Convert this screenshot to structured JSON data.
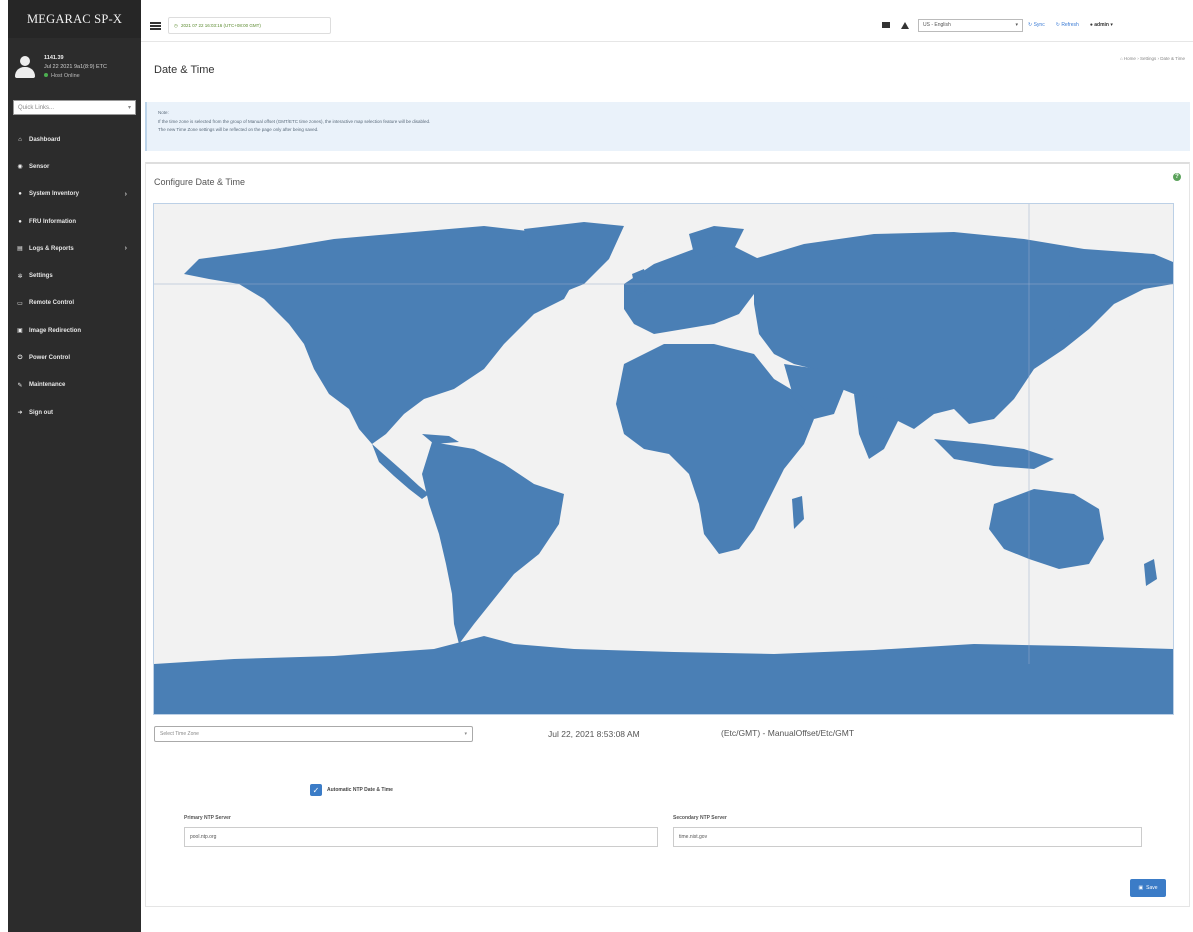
{
  "sidebar": {
    "brand": "MEGARAC SP-X",
    "user": {
      "name": "1141.39",
      "date": "Jul 22 2021 9a1(8:9) ETC",
      "status": "Host Online"
    },
    "quicklinks_placeholder": "Quick Links...",
    "items": [
      {
        "label": "Dashboard",
        "icon": "home-icon",
        "glyph": "⌂",
        "caret": false
      },
      {
        "label": "Sensor",
        "icon": "sensor-icon",
        "glyph": "◉",
        "caret": false
      },
      {
        "label": "System Inventory",
        "icon": "inventory-icon",
        "glyph": "●",
        "caret": true
      },
      {
        "label": "FRU Information",
        "icon": "fru-icon",
        "glyph": "●",
        "caret": false
      },
      {
        "label": "Logs & Reports",
        "icon": "chart-icon",
        "glyph": "▤",
        "caret": true
      },
      {
        "label": "Settings",
        "icon": "gear-icon",
        "glyph": "✲",
        "caret": false
      },
      {
        "label": "Remote Control",
        "icon": "monitor-icon",
        "glyph": "▭",
        "caret": false
      },
      {
        "label": "Image Redirection",
        "icon": "disc-icon",
        "glyph": "▣",
        "caret": false
      },
      {
        "label": "Power Control",
        "icon": "power-icon",
        "glyph": "⏻",
        "caret": false
      },
      {
        "label": "Maintenance",
        "icon": "wrench-icon",
        "glyph": "✎",
        "caret": false
      },
      {
        "label": "Sign out",
        "icon": "signout-icon",
        "glyph": "➜",
        "caret": false
      }
    ]
  },
  "topbar": {
    "datetime": "2021 07 22 16:03:16 (UTC+08:00 GMT)",
    "language": "US - English",
    "sync": "Sync",
    "refresh": "Refresh",
    "user": "admin"
  },
  "page": {
    "title": "Date & Time",
    "breadcrumb": [
      "Home",
      "Settings",
      "Date & Time"
    ],
    "note": {
      "heading": "Note:",
      "line1": "If the time zone is selected from the group of Manual offset (GMT/ETC time zones), the interactive map selection feature will be disabled.",
      "line2": "The new Time Zone settings will be reflected on the page only after being saved."
    }
  },
  "card": {
    "title": "Configure Date & Time",
    "timezone_placeholder": "Select Time Zone",
    "current_datetime": "Jul 22, 2021 8:53:08 AM",
    "current_zone": "(Etc/GMT) - ManualOffset/Etc/GMT",
    "ntp_checkbox_label": "Automatic NTP Date & Time",
    "primary_ntp_label": "Primary NTP Server",
    "primary_ntp_value": "pool.ntp.org",
    "secondary_ntp_label": "Secondary NTP Server",
    "secondary_ntp_value": "time.nist.gov",
    "save_label": "Save"
  },
  "colors": {
    "sidebar_bg": "#2c2c2c",
    "land": "#4a7fb5",
    "ocean": "#f2f2f2",
    "accent": "#3b7cc7",
    "note_bg": "#eaf2fa"
  }
}
